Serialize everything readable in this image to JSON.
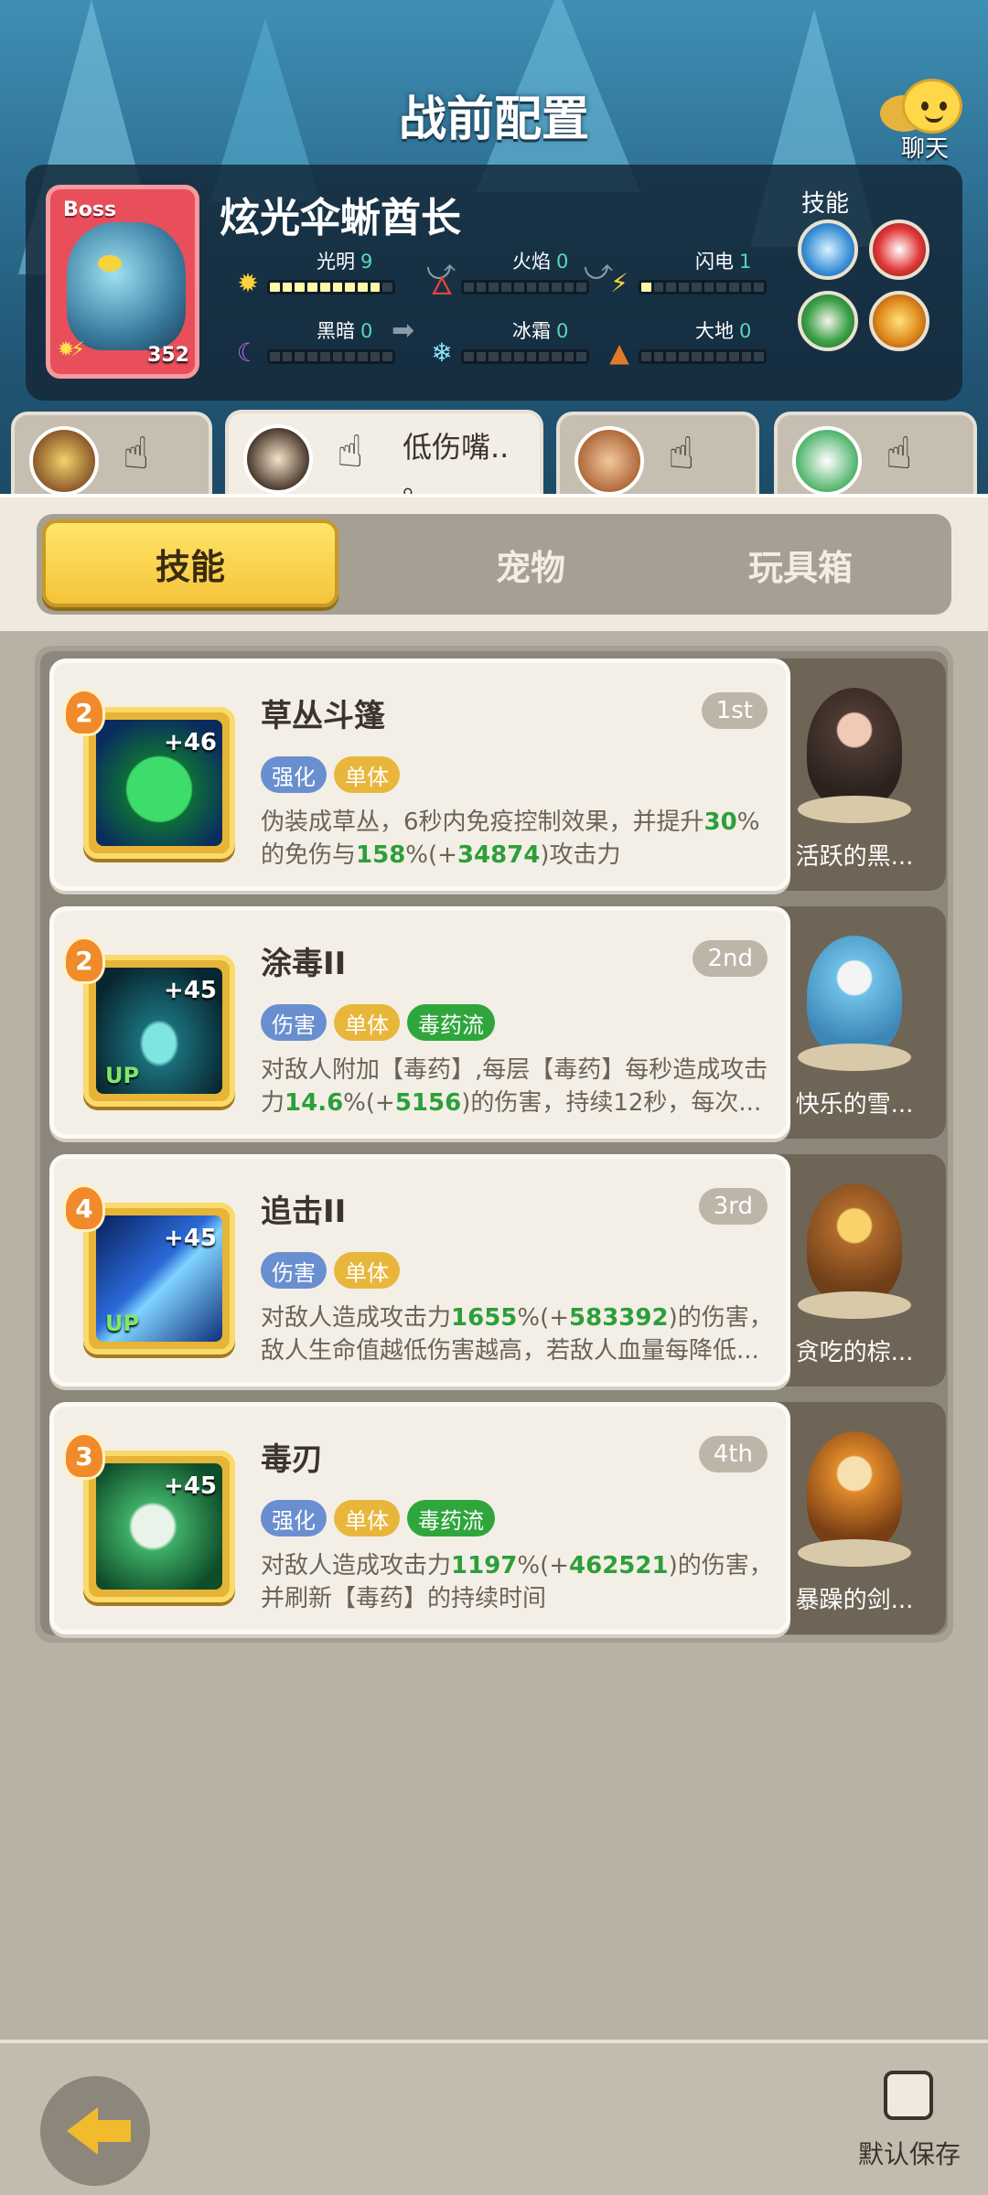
{
  "header": {
    "title": "战前配置",
    "chat_label": "聊天"
  },
  "boss": {
    "tag": "Boss",
    "name": "炫光伞蜥酋长",
    "level": "352",
    "skills_label": "技能",
    "elements": [
      {
        "name": "光明",
        "value": "9",
        "filled": 9,
        "icon": "sun-icon"
      },
      {
        "name": "火焰",
        "value": "0",
        "filled": 0,
        "icon": "flame-icon"
      },
      {
        "name": "闪电",
        "value": "1",
        "filled": 1,
        "icon": "lightning-icon"
      },
      {
        "name": "黑暗",
        "value": "0",
        "filled": 0,
        "icon": "moon-icon"
      },
      {
        "name": "冰霜",
        "value": "0",
        "filled": 0,
        "icon": "snowflake-icon"
      },
      {
        "name": "大地",
        "value": "0",
        "filled": 0,
        "icon": "earth-icon"
      }
    ]
  },
  "team": [
    {
      "name": ""
    },
    {
      "name_line1": "低伤嘴..",
      "name_line2": "。"
    },
    {
      "name": ""
    },
    {
      "name": ""
    }
  ],
  "tabs": [
    {
      "label": "技能"
    },
    {
      "label": "宠物"
    },
    {
      "label": "玩具箱"
    }
  ],
  "skills": [
    {
      "name": "草丛斗篷",
      "rank": "1st",
      "level": "2",
      "plus": "+46",
      "tags": [
        "强化",
        "单体"
      ],
      "desc": "伪装成草丛，6秒内免疫控制效果，并提升<b>30</b>%的免伤与<b>158</b>%(+<b>34874</b>)攻击力",
      "pet": "活跃的黑..."
    },
    {
      "name": "涂毒II",
      "rank": "2nd",
      "level": "2",
      "plus": "+45",
      "up": "UP",
      "tags": [
        "伤害",
        "单体",
        "毒药流"
      ],
      "desc": "对敌人附加【毒药】,每层【毒药】每秒造成攻击力<b>14.6</b>%(+<b>5156</b>)的伤害，持续12秒，每次...",
      "pet": "快乐的雪..."
    },
    {
      "name": "追击II",
      "rank": "3rd",
      "level": "4",
      "plus": "+45",
      "up": "UP",
      "tags": [
        "伤害",
        "单体"
      ],
      "desc": "对敌人造成攻击力<b>1655</b>%(+<b>583392</b>)的伤害，敌人生命值越低伤害越高，若敌人血量每降低...",
      "pet": "贪吃的棕..."
    },
    {
      "name": "毒刃",
      "rank": "4th",
      "level": "3",
      "plus": "+45",
      "tags": [
        "强化",
        "单体",
        "毒药流"
      ],
      "desc": "对敌人造成攻击力<b>1197</b>%(+<b>462521</b>)的伤害，并刷新【毒药】的持续时间",
      "pet": "暴躁的剑..."
    }
  ],
  "footer": {
    "save_label": "默认保存"
  }
}
